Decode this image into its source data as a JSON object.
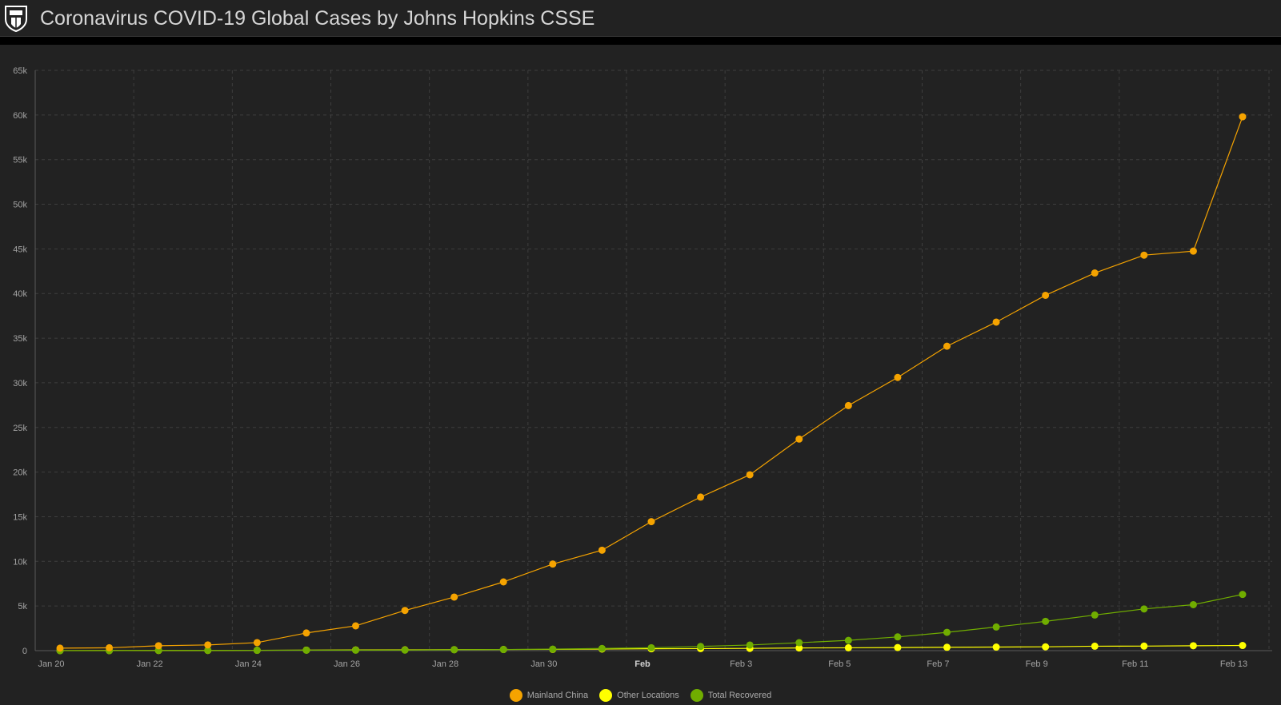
{
  "header": {
    "title": "Coronavirus COVID-19 Global Cases by Johns Hopkins CSSE",
    "logo_icon": "jhu-shield-logo"
  },
  "colors": {
    "background": "#222222",
    "grid": "#3e3e3e",
    "axis_text": "#a3a3a3",
    "mainland_china": "#f5a300",
    "other_locations": "#ffff00",
    "total_recovered": "#70ad00"
  },
  "chart_data": {
    "type": "line",
    "title": "",
    "xlabel": "",
    "ylabel": "",
    "ylim": [
      0,
      65000
    ],
    "y_ticks": [
      0,
      5000,
      10000,
      15000,
      20000,
      25000,
      30000,
      35000,
      40000,
      45000,
      50000,
      55000,
      60000,
      65000
    ],
    "y_tick_labels": [
      "0",
      "5k",
      "10k",
      "15k",
      "20k",
      "25k",
      "30k",
      "35k",
      "40k",
      "45k",
      "50k",
      "55k",
      "60k",
      "65k"
    ],
    "x_tick_labels": [
      "Jan 20",
      "Jan 22",
      "Jan 24",
      "Jan 26",
      "Jan 28",
      "Jan 30",
      "Feb",
      "Feb 3",
      "Feb 5",
      "Feb 7",
      "Feb 9",
      "Feb 11",
      "Feb 13"
    ],
    "x_tick_bold": [
      "Feb"
    ],
    "x": [
      "Jan 20",
      "Jan 21",
      "Jan 22",
      "Jan 23",
      "Jan 24",
      "Jan 25",
      "Jan 26",
      "Jan 27",
      "Jan 28",
      "Jan 29",
      "Jan 30",
      "Jan 31",
      "Feb 1",
      "Feb 2",
      "Feb 3",
      "Feb 4",
      "Feb 5",
      "Feb 6",
      "Feb 7",
      "Feb 8",
      "Feb 9",
      "Feb 10",
      "Feb 11",
      "Feb 12",
      "Feb 13"
    ],
    "grid": true,
    "legend_position": "bottom-center",
    "series": [
      {
        "name": "Mainland China",
        "color_key": "mainland_china",
        "values": [
          280,
          320,
          550,
          640,
          900,
          1980,
          2780,
          4500,
          6000,
          7700,
          9700,
          11250,
          14450,
          17200,
          19700,
          23700,
          27450,
          30600,
          34100,
          36800,
          39800,
          42300,
          44300,
          44750,
          59800
        ]
      },
      {
        "name": "Other Locations",
        "color_key": "other_locations",
        "values": [
          6,
          10,
          17,
          24,
          40,
          60,
          80,
          90,
          110,
          130,
          140,
          180,
          210,
          230,
          250,
          300,
          320,
          350,
          380,
          400,
          430,
          500,
          510,
          550,
          580
        ]
      },
      {
        "name": "Total Recovered",
        "color_key": "total_recovered",
        "values": [
          0,
          0,
          28,
          34,
          38,
          49,
          51,
          60,
          103,
          124,
          171,
          243,
          328,
          475,
          632,
          892,
          1152,
          1540,
          2050,
          2650,
          3280,
          3990,
          4670,
          5150,
          6300
        ]
      }
    ]
  },
  "legend": {
    "items": [
      {
        "label": "Mainland China",
        "color_key": "mainland_china"
      },
      {
        "label": "Other Locations",
        "color_key": "other_locations"
      },
      {
        "label": "Total Recovered",
        "color_key": "total_recovered"
      }
    ]
  }
}
